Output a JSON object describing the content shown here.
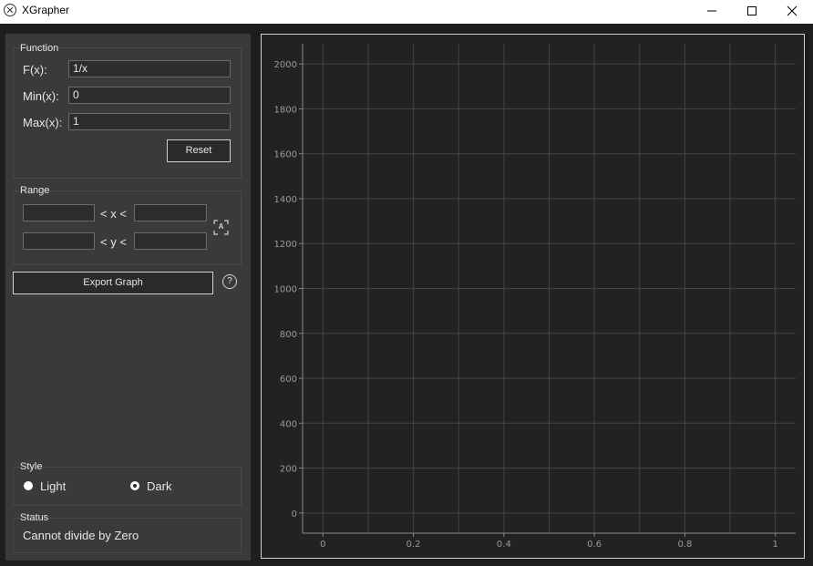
{
  "window": {
    "title": "XGrapher"
  },
  "function_group": {
    "title": "Function",
    "fx_label": "F(x):",
    "fx_value": "1/x",
    "min_label": "Min(x):",
    "min_value": "0",
    "max_label": "Max(x):",
    "max_value": "1",
    "reset_label": "Reset"
  },
  "range_group": {
    "title": "Range",
    "x_sep": "< x <",
    "y_sep": "< y <",
    "x_min": "",
    "x_max": "",
    "y_min": "",
    "y_max": "",
    "auto_label": "A"
  },
  "export_label": "Export Graph",
  "help_label": "?",
  "style_group": {
    "title": "Style",
    "options": [
      {
        "label": "Light",
        "selected": false
      },
      {
        "label": "Dark",
        "selected": true
      }
    ]
  },
  "status_group": {
    "title": "Status",
    "message": "Cannot divide by Zero"
  },
  "chart_data": {
    "type": "line",
    "x": [],
    "y": [],
    "xlim": [
      -0.045,
      1.045
    ],
    "ylim": [
      -90,
      2090
    ],
    "xticks": [
      0,
      0.2,
      0.4,
      0.6,
      0.8,
      1
    ],
    "xtick_labels": [
      "0",
      "0.2",
      "0.4",
      "0.6",
      "0.8",
      "1"
    ],
    "yticks": [
      0,
      200,
      400,
      600,
      800,
      1000,
      1200,
      1400,
      1600,
      1800,
      2000
    ],
    "ytick_labels": [
      "0",
      "200",
      "400",
      "600",
      "800",
      "1000",
      "1200",
      "1400",
      "1600",
      "1800",
      "2000"
    ],
    "grid": true,
    "colors": {
      "background": "#222222",
      "grid": "#444444",
      "axis": "#888888",
      "tick_text": "#9a9a9a"
    }
  }
}
